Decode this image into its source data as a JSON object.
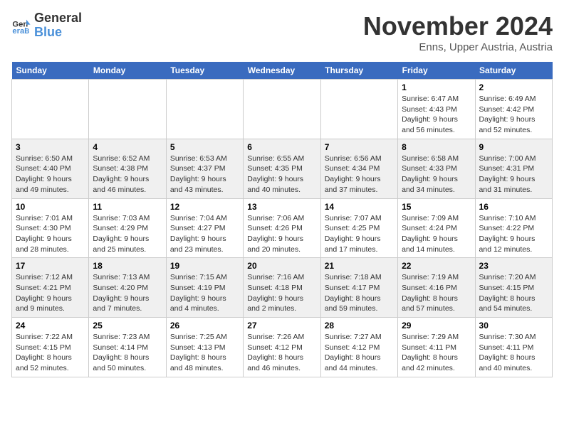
{
  "logo": {
    "text_general": "General",
    "text_blue": "Blue"
  },
  "header": {
    "month": "November 2024",
    "location": "Enns, Upper Austria, Austria"
  },
  "days_of_week": [
    "Sunday",
    "Monday",
    "Tuesday",
    "Wednesday",
    "Thursday",
    "Friday",
    "Saturday"
  ],
  "weeks": [
    [
      {
        "day": "",
        "info": ""
      },
      {
        "day": "",
        "info": ""
      },
      {
        "day": "",
        "info": ""
      },
      {
        "day": "",
        "info": ""
      },
      {
        "day": "",
        "info": ""
      },
      {
        "day": "1",
        "info": "Sunrise: 6:47 AM\nSunset: 4:43 PM\nDaylight: 9 hours and 56 minutes."
      },
      {
        "day": "2",
        "info": "Sunrise: 6:49 AM\nSunset: 4:42 PM\nDaylight: 9 hours and 52 minutes."
      }
    ],
    [
      {
        "day": "3",
        "info": "Sunrise: 6:50 AM\nSunset: 4:40 PM\nDaylight: 9 hours and 49 minutes."
      },
      {
        "day": "4",
        "info": "Sunrise: 6:52 AM\nSunset: 4:38 PM\nDaylight: 9 hours and 46 minutes."
      },
      {
        "day": "5",
        "info": "Sunrise: 6:53 AM\nSunset: 4:37 PM\nDaylight: 9 hours and 43 minutes."
      },
      {
        "day": "6",
        "info": "Sunrise: 6:55 AM\nSunset: 4:35 PM\nDaylight: 9 hours and 40 minutes."
      },
      {
        "day": "7",
        "info": "Sunrise: 6:56 AM\nSunset: 4:34 PM\nDaylight: 9 hours and 37 minutes."
      },
      {
        "day": "8",
        "info": "Sunrise: 6:58 AM\nSunset: 4:33 PM\nDaylight: 9 hours and 34 minutes."
      },
      {
        "day": "9",
        "info": "Sunrise: 7:00 AM\nSunset: 4:31 PM\nDaylight: 9 hours and 31 minutes."
      }
    ],
    [
      {
        "day": "10",
        "info": "Sunrise: 7:01 AM\nSunset: 4:30 PM\nDaylight: 9 hours and 28 minutes."
      },
      {
        "day": "11",
        "info": "Sunrise: 7:03 AM\nSunset: 4:29 PM\nDaylight: 9 hours and 25 minutes."
      },
      {
        "day": "12",
        "info": "Sunrise: 7:04 AM\nSunset: 4:27 PM\nDaylight: 9 hours and 23 minutes."
      },
      {
        "day": "13",
        "info": "Sunrise: 7:06 AM\nSunset: 4:26 PM\nDaylight: 9 hours and 20 minutes."
      },
      {
        "day": "14",
        "info": "Sunrise: 7:07 AM\nSunset: 4:25 PM\nDaylight: 9 hours and 17 minutes."
      },
      {
        "day": "15",
        "info": "Sunrise: 7:09 AM\nSunset: 4:24 PM\nDaylight: 9 hours and 14 minutes."
      },
      {
        "day": "16",
        "info": "Sunrise: 7:10 AM\nSunset: 4:22 PM\nDaylight: 9 hours and 12 minutes."
      }
    ],
    [
      {
        "day": "17",
        "info": "Sunrise: 7:12 AM\nSunset: 4:21 PM\nDaylight: 9 hours and 9 minutes."
      },
      {
        "day": "18",
        "info": "Sunrise: 7:13 AM\nSunset: 4:20 PM\nDaylight: 9 hours and 7 minutes."
      },
      {
        "day": "19",
        "info": "Sunrise: 7:15 AM\nSunset: 4:19 PM\nDaylight: 9 hours and 4 minutes."
      },
      {
        "day": "20",
        "info": "Sunrise: 7:16 AM\nSunset: 4:18 PM\nDaylight: 9 hours and 2 minutes."
      },
      {
        "day": "21",
        "info": "Sunrise: 7:18 AM\nSunset: 4:17 PM\nDaylight: 8 hours and 59 minutes."
      },
      {
        "day": "22",
        "info": "Sunrise: 7:19 AM\nSunset: 4:16 PM\nDaylight: 8 hours and 57 minutes."
      },
      {
        "day": "23",
        "info": "Sunrise: 7:20 AM\nSunset: 4:15 PM\nDaylight: 8 hours and 54 minutes."
      }
    ],
    [
      {
        "day": "24",
        "info": "Sunrise: 7:22 AM\nSunset: 4:15 PM\nDaylight: 8 hours and 52 minutes."
      },
      {
        "day": "25",
        "info": "Sunrise: 7:23 AM\nSunset: 4:14 PM\nDaylight: 8 hours and 50 minutes."
      },
      {
        "day": "26",
        "info": "Sunrise: 7:25 AM\nSunset: 4:13 PM\nDaylight: 8 hours and 48 minutes."
      },
      {
        "day": "27",
        "info": "Sunrise: 7:26 AM\nSunset: 4:12 PM\nDaylight: 8 hours and 46 minutes."
      },
      {
        "day": "28",
        "info": "Sunrise: 7:27 AM\nSunset: 4:12 PM\nDaylight: 8 hours and 44 minutes."
      },
      {
        "day": "29",
        "info": "Sunrise: 7:29 AM\nSunset: 4:11 PM\nDaylight: 8 hours and 42 minutes."
      },
      {
        "day": "30",
        "info": "Sunrise: 7:30 AM\nSunset: 4:11 PM\nDaylight: 8 hours and 40 minutes."
      }
    ]
  ]
}
